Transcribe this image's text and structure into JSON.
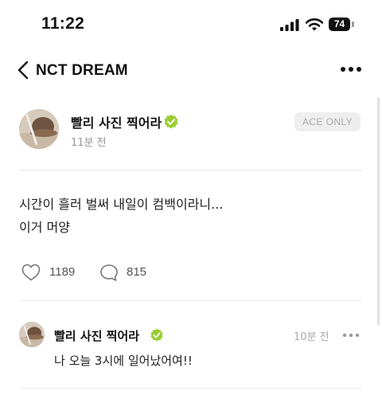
{
  "status_bar": {
    "time": "11:22",
    "battery": "74"
  },
  "header": {
    "title": "NCT DREAM"
  },
  "post": {
    "author": "빨리 사진 찍어라",
    "time_ago": "11분 전",
    "badge": "ACE ONLY",
    "body_lines": [
      "시간이 흘러 벌써 내일이 컴백이라니...",
      "이거 머양"
    ],
    "likes": "1189",
    "comments": "815"
  },
  "comment": {
    "author": "빨리 사진 찍어라",
    "time_ago": "10분 전",
    "text": "나 오늘 3시에 일어났어여!!"
  },
  "colors": {
    "verified": "#9ACD32",
    "badge_bg": "#EEEEEE",
    "badge_text": "#AAAAAA"
  }
}
